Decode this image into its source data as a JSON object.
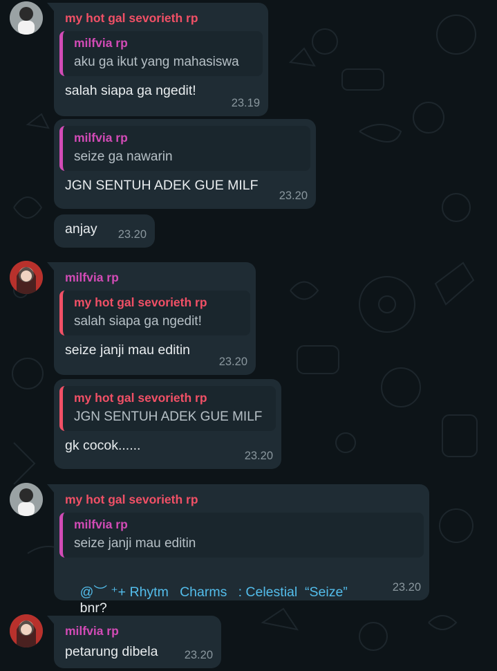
{
  "chat": {
    "messages": [
      {
        "sender": "my hot gal sevorieth rp",
        "quote_name": "milfvia rp",
        "quote_text": "aku ga ikut yang mahasiswa",
        "text": "salah siapa ga ngedit!",
        "time": "23.19"
      },
      {
        "quote_name": "milfvia rp",
        "quote_text": "seize ga nawarin",
        "text": "JGN SENTUH ADEK GUE MILF",
        "time": "23.20"
      },
      {
        "text": "anjay",
        "time": "23.20"
      },
      {
        "sender": "milfvia rp",
        "quote_name": "my hot gal sevorieth rp",
        "quote_text": "salah siapa ga ngedit!",
        "text": "seize janji mau editin",
        "time": "23.20"
      },
      {
        "quote_name": "my hot gal sevorieth rp",
        "quote_text": "JGN SENTUH ADEK GUE MILF",
        "text": "gk cocok......",
        "time": "23.20"
      },
      {
        "sender": "my hot gal sevorieth rp",
        "quote_name": "milfvia rp",
        "quote_text": "seize janji mau editin",
        "mention": "@︶ ⁺+ Rhytm   Charms   : Celestial  “Seize”",
        "text": "bnr?",
        "time": "23.20"
      },
      {
        "sender": "milfvia rp",
        "text": "petarung dibela",
        "time": "23.20"
      }
    ]
  },
  "colors": {
    "bubble": "#1f2c34",
    "background": "#0d1418",
    "sender_milfvia": "#d24bb6",
    "sender_gal": "#f15066",
    "mention": "#53bdeb"
  }
}
